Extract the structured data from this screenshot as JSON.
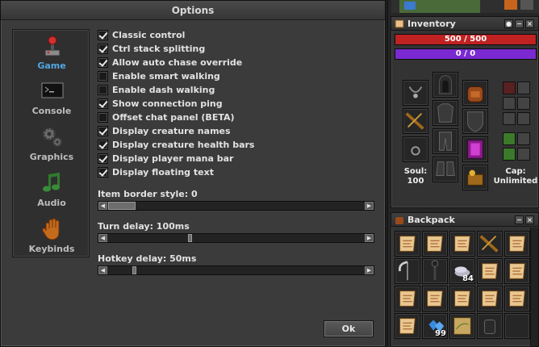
{
  "options_window": {
    "title": "Options",
    "tabs": [
      {
        "label": "Game",
        "icon": "joystick-icon",
        "active": true
      },
      {
        "label": "Console",
        "icon": "console-icon",
        "active": false
      },
      {
        "label": "Graphics",
        "icon": "gears-icon",
        "active": false
      },
      {
        "label": "Audio",
        "icon": "music-note-icon",
        "active": false
      },
      {
        "label": "Keybinds",
        "icon": "hand-icon",
        "active": false
      }
    ],
    "options": [
      {
        "label": "Classic control",
        "checked": true
      },
      {
        "label": "Ctrl stack splitting",
        "checked": true
      },
      {
        "label": "Allow auto chase override",
        "checked": true
      },
      {
        "label": "Enable smart walking",
        "checked": false
      },
      {
        "label": "Enable dash walking",
        "checked": false
      },
      {
        "label": "Show connection ping",
        "checked": true
      },
      {
        "label": "Offset chat panel (BETA)",
        "checked": false
      },
      {
        "label": "Display creature names",
        "checked": true
      },
      {
        "label": "Display creature health bars",
        "checked": true
      },
      {
        "label": "Display player mana bar",
        "checked": true
      },
      {
        "label": "Display floating text",
        "checked": true
      }
    ],
    "sliders": [
      {
        "label": "Item border style: 0",
        "position": 0.0
      },
      {
        "label": "Turn delay: 100ms",
        "position": 0.33
      },
      {
        "label": "Hotkey delay: 50ms",
        "position": 0.12
      }
    ],
    "ok_label": "Ok"
  },
  "inventory": {
    "title": "Inventory",
    "health": "500 / 500",
    "mana": "0 / 0",
    "soul_label": "Soul:",
    "soul_value": "100",
    "cap_label": "Cap:",
    "cap_value": "Unlimited",
    "colors": {
      "health": "#c02222",
      "mana": "#7a2ad0"
    }
  },
  "backpack": {
    "title": "Backpack",
    "items": [
      {
        "icon": "scroll-icon",
        "count": ""
      },
      {
        "icon": "scroll-icon",
        "count": ""
      },
      {
        "icon": "scroll-icon",
        "count": ""
      },
      {
        "icon": "crossbow-icon",
        "count": ""
      },
      {
        "icon": "scroll-icon",
        "count": ""
      },
      {
        "icon": "scythe-icon",
        "count": ""
      },
      {
        "icon": "staff-icon",
        "count": ""
      },
      {
        "icon": "coins-icon",
        "count": "84"
      },
      {
        "icon": "scroll-icon",
        "count": ""
      },
      {
        "icon": "scroll-icon",
        "count": ""
      },
      {
        "icon": "scroll-icon",
        "count": ""
      },
      {
        "icon": "scroll-icon",
        "count": ""
      },
      {
        "icon": "scroll-icon",
        "count": ""
      },
      {
        "icon": "scroll-icon",
        "count": ""
      },
      {
        "icon": "scroll-icon",
        "count": ""
      },
      {
        "icon": "scroll-icon",
        "count": ""
      },
      {
        "icon": "gems-icon",
        "count": "99"
      },
      {
        "icon": "map-icon",
        "count": ""
      },
      {
        "icon": "bag-icon",
        "count": ""
      },
      {
        "icon": "empty-slot",
        "count": ""
      }
    ]
  }
}
